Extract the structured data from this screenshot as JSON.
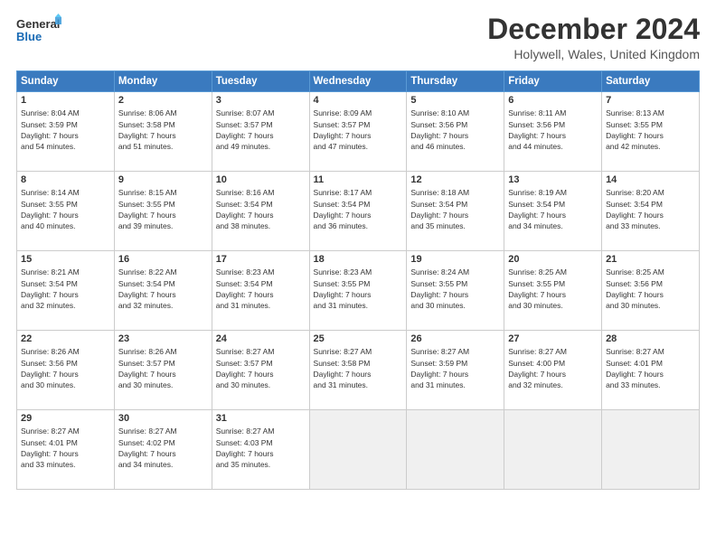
{
  "header": {
    "logo_line1": "General",
    "logo_line2": "Blue",
    "title": "December 2024",
    "subtitle": "Holywell, Wales, United Kingdom"
  },
  "calendar": {
    "days_of_week": [
      "Sunday",
      "Monday",
      "Tuesday",
      "Wednesday",
      "Thursday",
      "Friday",
      "Saturday"
    ],
    "weeks": [
      [
        {
          "day": "",
          "empty": true
        },
        {
          "day": "",
          "empty": true
        },
        {
          "day": "",
          "empty": true
        },
        {
          "day": "",
          "empty": true
        },
        {
          "day": "",
          "empty": true
        },
        {
          "day": "",
          "empty": true
        },
        {
          "day": "1",
          "sunrise": "Sunrise: 8:13 AM",
          "sunset": "Sunset: 3:55 PM",
          "daylight": "Daylight: 7 hours and 42 minutes."
        }
      ],
      [
        {
          "day": "2",
          "sunrise": "Sunrise: 8:06 AM",
          "sunset": "Sunset: 3:58 PM",
          "daylight": "Daylight: 7 hours and 51 minutes."
        },
        {
          "day": "3",
          "sunrise": "Sunrise: 8:07 AM",
          "sunset": "Sunset: 3:57 PM",
          "daylight": "Daylight: 7 hours and 49 minutes."
        },
        {
          "day": "4",
          "sunrise": "Sunrise: 8:09 AM",
          "sunset": "Sunset: 3:57 PM",
          "daylight": "Daylight: 7 hours and 47 minutes."
        },
        {
          "day": "5",
          "sunrise": "Sunrise: 8:10 AM",
          "sunset": "Sunset: 3:56 PM",
          "daylight": "Daylight: 7 hours and 46 minutes."
        },
        {
          "day": "6",
          "sunrise": "Sunrise: 8:11 AM",
          "sunset": "Sunset: 3:56 PM",
          "daylight": "Daylight: 7 hours and 44 minutes."
        },
        {
          "day": "7",
          "sunrise": "Sunrise: 8:13 AM",
          "sunset": "Sunset: 3:55 PM",
          "daylight": "Daylight: 7 hours and 42 minutes."
        }
      ],
      [
        {
          "day": "1",
          "sunrise": "Sunrise: 8:04 AM",
          "sunset": "Sunset: 3:59 PM",
          "daylight": "Daylight: 7 hours and 54 minutes."
        },
        {
          "day": "8",
          "sunrise": "Sunrise: 8:14 AM",
          "sunset": "Sunset: 3:55 PM",
          "daylight": "Daylight: 7 hours and 40 minutes."
        },
        {
          "day": "9",
          "sunrise": "Sunrise: 8:15 AM",
          "sunset": "Sunset: 3:55 PM",
          "daylight": "Daylight: 7 hours and 39 minutes."
        },
        {
          "day": "10",
          "sunrise": "Sunrise: 8:16 AM",
          "sunset": "Sunset: 3:54 PM",
          "daylight": "Daylight: 7 hours and 38 minutes."
        },
        {
          "day": "11",
          "sunrise": "Sunrise: 8:17 AM",
          "sunset": "Sunset: 3:54 PM",
          "daylight": "Daylight: 7 hours and 36 minutes."
        },
        {
          "day": "12",
          "sunrise": "Sunrise: 8:18 AM",
          "sunset": "Sunset: 3:54 PM",
          "daylight": "Daylight: 7 hours and 35 minutes."
        },
        {
          "day": "13",
          "sunrise": "Sunrise: 8:19 AM",
          "sunset": "Sunset: 3:54 PM",
          "daylight": "Daylight: 7 hours and 34 minutes."
        },
        {
          "day": "14",
          "sunrise": "Sunrise: 8:20 AM",
          "sunset": "Sunset: 3:54 PM",
          "daylight": "Daylight: 7 hours and 33 minutes."
        }
      ],
      [
        {
          "day": "15",
          "sunrise": "Sunrise: 8:21 AM",
          "sunset": "Sunset: 3:54 PM",
          "daylight": "Daylight: 7 hours and 32 minutes."
        },
        {
          "day": "16",
          "sunrise": "Sunrise: 8:22 AM",
          "sunset": "Sunset: 3:54 PM",
          "daylight": "Daylight: 7 hours and 32 minutes."
        },
        {
          "day": "17",
          "sunrise": "Sunrise: 8:23 AM",
          "sunset": "Sunset: 3:54 PM",
          "daylight": "Daylight: 7 hours and 31 minutes."
        },
        {
          "day": "18",
          "sunrise": "Sunrise: 8:23 AM",
          "sunset": "Sunset: 3:55 PM",
          "daylight": "Daylight: 7 hours and 31 minutes."
        },
        {
          "day": "19",
          "sunrise": "Sunrise: 8:24 AM",
          "sunset": "Sunset: 3:55 PM",
          "daylight": "Daylight: 7 hours and 30 minutes."
        },
        {
          "day": "20",
          "sunrise": "Sunrise: 8:25 AM",
          "sunset": "Sunset: 3:55 PM",
          "daylight": "Daylight: 7 hours and 30 minutes."
        },
        {
          "day": "21",
          "sunrise": "Sunrise: 8:25 AM",
          "sunset": "Sunset: 3:56 PM",
          "daylight": "Daylight: 7 hours and 30 minutes."
        }
      ],
      [
        {
          "day": "22",
          "sunrise": "Sunrise: 8:26 AM",
          "sunset": "Sunset: 3:56 PM",
          "daylight": "Daylight: 7 hours and 30 minutes."
        },
        {
          "day": "23",
          "sunrise": "Sunrise: 8:26 AM",
          "sunset": "Sunset: 3:57 PM",
          "daylight": "Daylight: 7 hours and 30 minutes."
        },
        {
          "day": "24",
          "sunrise": "Sunrise: 8:27 AM",
          "sunset": "Sunset: 3:57 PM",
          "daylight": "Daylight: 7 hours and 30 minutes."
        },
        {
          "day": "25",
          "sunrise": "Sunrise: 8:27 AM",
          "sunset": "Sunset: 3:58 PM",
          "daylight": "Daylight: 7 hours and 31 minutes."
        },
        {
          "day": "26",
          "sunrise": "Sunrise: 8:27 AM",
          "sunset": "Sunset: 3:59 PM",
          "daylight": "Daylight: 7 hours and 31 minutes."
        },
        {
          "day": "27",
          "sunrise": "Sunrise: 8:27 AM",
          "sunset": "Sunset: 4:00 PM",
          "daylight": "Daylight: 7 hours and 32 minutes."
        },
        {
          "day": "28",
          "sunrise": "Sunrise: 8:27 AM",
          "sunset": "Sunset: 4:01 PM",
          "daylight": "Daylight: 7 hours and 33 minutes."
        }
      ],
      [
        {
          "day": "29",
          "sunrise": "Sunrise: 8:27 AM",
          "sunset": "Sunset: 4:01 PM",
          "daylight": "Daylight: 7 hours and 33 minutes."
        },
        {
          "day": "30",
          "sunrise": "Sunrise: 8:27 AM",
          "sunset": "Sunset: 4:02 PM",
          "daylight": "Daylight: 7 hours and 34 minutes."
        },
        {
          "day": "31",
          "sunrise": "Sunrise: 8:27 AM",
          "sunset": "Sunset: 4:03 PM",
          "daylight": "Daylight: 7 hours and 35 minutes."
        },
        {
          "day": "",
          "empty": true
        },
        {
          "day": "",
          "empty": true
        },
        {
          "day": "",
          "empty": true
        },
        {
          "day": "",
          "empty": true
        }
      ]
    ]
  }
}
